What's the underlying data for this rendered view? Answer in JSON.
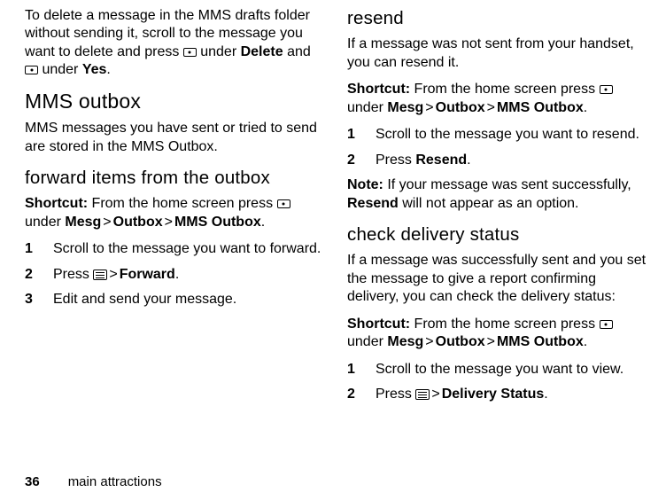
{
  "left": {
    "intro1": "To delete a message in the MMS drafts folder without sending it, scroll to the message you want to delete and press ",
    "intro_under1": " under ",
    "intro_delete": "Delete",
    "intro_and": " and ",
    "intro_under2": " under ",
    "intro_yes": "Yes",
    "section_outbox": "MMS outbox",
    "outbox_desc": "MMS messages you have sent or tried to send are stored in the MMS Outbox.",
    "sub_forward": "forward items from the outbox",
    "shortcut_label": "Shortcut:",
    "shortcut_text1": " From the home screen press ",
    "shortcut_under": " under ",
    "mesg": "Mesg",
    "outbox": "Outbox",
    "mmsoutbox": "MMS Outbox",
    "step1": "Scroll to the message you want to forward.",
    "step2a": "Press ",
    "step2b": "Forward",
    "step3": "Edit and send your message."
  },
  "right": {
    "sub_resend": "resend",
    "resend_intro": "If a message was not sent from your handset, you can resend it.",
    "shortcut_label": "Shortcut:",
    "shortcut_text1": " From the home screen press ",
    "shortcut_under": " under ",
    "mesg": "Mesg",
    "outbox": "Outbox",
    "mmsoutbox": "MMS Outbox",
    "r_step1": "Scroll to the message you want to resend.",
    "r_step2a": "Press ",
    "r_step2b": "Resend",
    "note_label": "Note:",
    "note_text1": " If your message was sent successfully, ",
    "note_resend": "Resend",
    "note_text2": " will not appear as an option.",
    "sub_delivery": "check delivery status",
    "delivery_intro": "If a message was successfully sent and you set the message to give a report confirming delivery, you can check the delivery status:",
    "d_step1": "Scroll to the message you want to view.",
    "d_step2a": "Press ",
    "d_step2b": "Delivery Status"
  },
  "footer": {
    "page": "36",
    "chapter": "main attractions"
  },
  "nums": {
    "n1": "1",
    "n2": "2",
    "n3": "3"
  },
  "glyph": {
    "period": ".",
    "gt": ">"
  }
}
